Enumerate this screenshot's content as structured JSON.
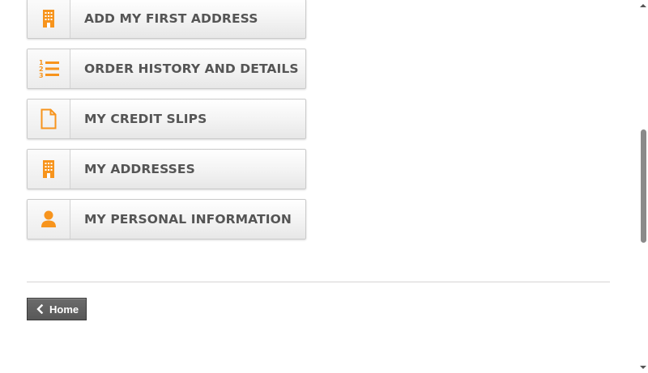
{
  "menu": {
    "items": [
      {
        "label": "ADD MY FIRST ADDRESS",
        "icon": "building-icon"
      },
      {
        "label": "ORDER HISTORY AND DETAILS",
        "icon": "ordered-list-icon"
      },
      {
        "label": "MY CREDIT SLIPS",
        "icon": "file-icon"
      },
      {
        "label": "MY ADDRESSES",
        "icon": "building-icon"
      },
      {
        "label": "MY PERSONAL INFORMATION",
        "icon": "user-icon"
      }
    ]
  },
  "footer": {
    "home_label": "Home"
  },
  "colors": {
    "icon_accent": "#f7941d",
    "label_text": "#555555",
    "home_button": "#5f5f5f"
  }
}
